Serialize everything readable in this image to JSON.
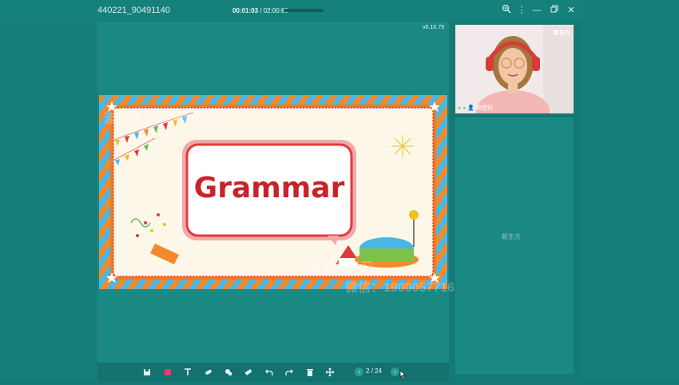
{
  "window": {
    "title": "440221_90491140",
    "elapsed": "00:01:03",
    "total": "/ 02:00:00",
    "progress_fraction": 0.0088
  },
  "board": {
    "version": "v0.10.79",
    "slide": {
      "heading": "Grammar"
    },
    "watermark": {
      "line1": "添加微信1900057716",
      "line2": "张姐爱学习",
      "line3": "微信：1900057716"
    }
  },
  "toolbar": {
    "page_current": "2",
    "page_separator": "/",
    "page_total": "24"
  },
  "video": {
    "logo": "新东方",
    "name": "杨晋钰"
  },
  "panel": {
    "logo": "新东方"
  },
  "colors": {
    "teal_bg": "#157a76",
    "accent_green": "#2fd28e",
    "heading_red": "#c8232a"
  }
}
